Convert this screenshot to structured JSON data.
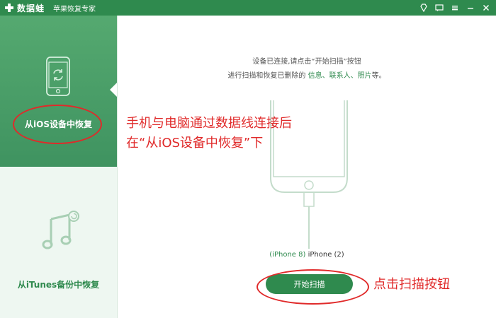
{
  "app": {
    "brand": "数据蛙",
    "subtitle": "苹果恢复专家"
  },
  "sidebar": {
    "items": [
      {
        "label": "从iOS设备中恢复",
        "active": true,
        "icon": "phone-refresh-icon"
      },
      {
        "label": "从iTunes备份中恢复",
        "active": false,
        "icon": "music-note-icon"
      }
    ]
  },
  "main": {
    "instruction_line1": "设备已连接,请点击“开始扫描”按钮",
    "instruction_line2_prefix": "进行扫描和恢复已删除的 ",
    "instruction_highlight": "信息、联系人、照片",
    "instruction_line2_suffix": "等。",
    "device_model": "(iPhone 8)",
    "device_name": " iPhone (2)",
    "scan_button": "开始扫描"
  },
  "annotations": {
    "note1": "手机与电脑通过数据线连接后",
    "note2": "在“从iOS设备中恢复”下",
    "note3": "点击扫描按钮"
  },
  "colors": {
    "brand_green": "#2f8a4e",
    "annotation_red": "#e02a2a"
  }
}
